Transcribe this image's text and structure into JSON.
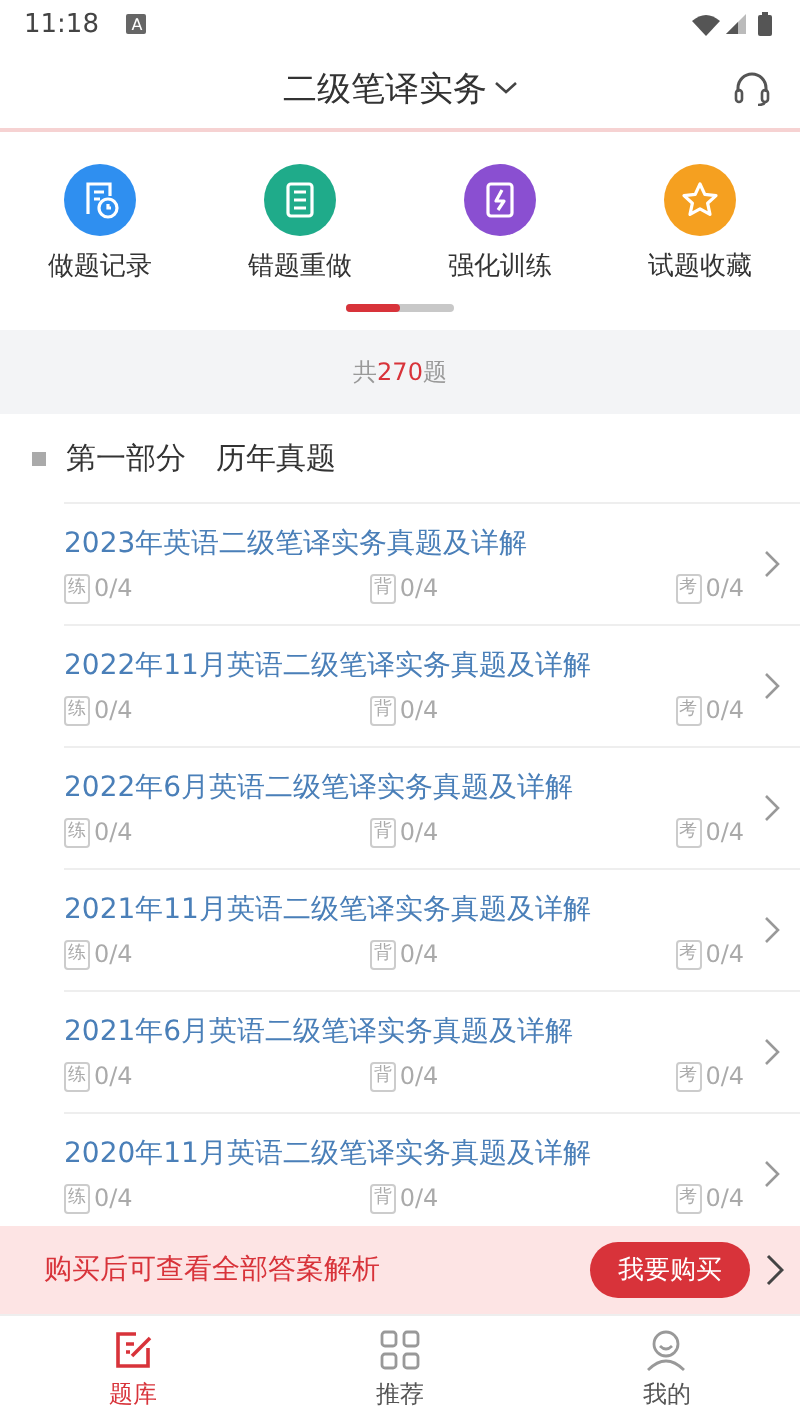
{
  "status_bar": {
    "time": "11:18",
    "notification": "A"
  },
  "header": {
    "title": "二级笔译实务"
  },
  "shortcuts": [
    {
      "label": "做题记录",
      "kind": "record",
      "color": "#2f8ff0"
    },
    {
      "label": "错题重做",
      "kind": "notebook",
      "color": "#1fab8a"
    },
    {
      "label": "强化训练",
      "kind": "bolt",
      "color": "#8a4fd1"
    },
    {
      "label": "试题收藏",
      "kind": "star",
      "color": "#f5a020"
    }
  ],
  "summary": {
    "prefix": "共",
    "count": "270",
    "suffix": "题"
  },
  "section": {
    "title": "第一部分　历年真题"
  },
  "papers": [
    {
      "title": "2023年英语二级笔译实务真题及详解",
      "stats": [
        {
          "tag": "练",
          "value": "0/4"
        },
        {
          "tag": "背",
          "value": "0/4"
        },
        {
          "tag": "考",
          "value": "0/4"
        }
      ]
    },
    {
      "title": "2022年11月英语二级笔译实务真题及详解",
      "stats": [
        {
          "tag": "练",
          "value": "0/4"
        },
        {
          "tag": "背",
          "value": "0/4"
        },
        {
          "tag": "考",
          "value": "0/4"
        }
      ]
    },
    {
      "title": "2022年6月英语二级笔译实务真题及详解",
      "stats": [
        {
          "tag": "练",
          "value": "0/4"
        },
        {
          "tag": "背",
          "value": "0/4"
        },
        {
          "tag": "考",
          "value": "0/4"
        }
      ]
    },
    {
      "title": "2021年11月英语二级笔译实务真题及详解",
      "stats": [
        {
          "tag": "练",
          "value": "0/4"
        },
        {
          "tag": "背",
          "value": "0/4"
        },
        {
          "tag": "考",
          "value": "0/4"
        }
      ]
    },
    {
      "title": "2021年6月英语二级笔译实务真题及详解",
      "stats": [
        {
          "tag": "练",
          "value": "0/4"
        },
        {
          "tag": "背",
          "value": "0/4"
        },
        {
          "tag": "考",
          "value": "0/4"
        }
      ]
    },
    {
      "title": "2020年11月英语二级笔译实务真题及详解",
      "stats": [
        {
          "tag": "练",
          "value": "0/4"
        },
        {
          "tag": "背",
          "value": "0/4"
        },
        {
          "tag": "考",
          "value": "0/4"
        }
      ]
    }
  ],
  "purchase_banner": {
    "text": "购买后可查看全部答案解析",
    "button": "我要购买"
  },
  "bottom_nav": [
    {
      "label": "题库",
      "kind": "edit",
      "selected": true
    },
    {
      "label": "推荐",
      "kind": "grid",
      "selected": false
    },
    {
      "label": "我的",
      "kind": "user",
      "selected": false
    }
  ]
}
